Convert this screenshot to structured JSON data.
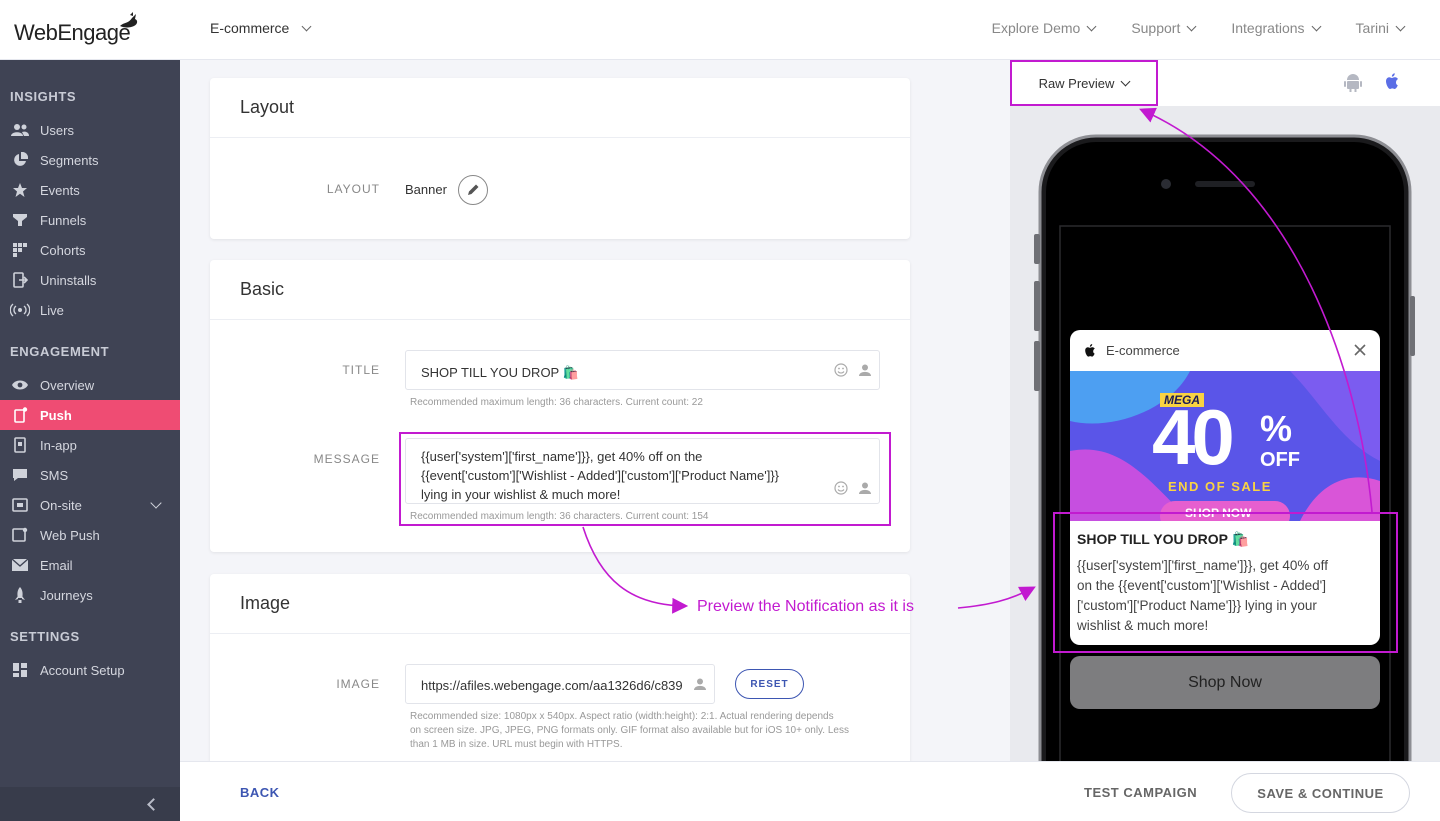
{
  "topbar": {
    "logo_text": "WebEngage",
    "project": "E-commerce",
    "nav": [
      {
        "label": "Explore Demo"
      },
      {
        "label": "Support"
      },
      {
        "label": "Integrations"
      },
      {
        "label": "Tarini"
      }
    ]
  },
  "sidebar": {
    "sections": {
      "insights": "INSIGHTS",
      "engagement": "ENGAGEMENT",
      "settings": "SETTINGS"
    },
    "insights_items": [
      "Users",
      "Segments",
      "Events",
      "Funnels",
      "Cohorts",
      "Uninstalls",
      "Live"
    ],
    "engagement_items": [
      "Overview",
      "Push",
      "In-app",
      "SMS",
      "On-site",
      "Web Push",
      "Email",
      "Journeys"
    ],
    "settings_items": [
      "Account Setup"
    ],
    "active_item": "Push"
  },
  "layout_card": {
    "title": "Layout",
    "label": "LAYOUT",
    "value": "Banner"
  },
  "basic_card": {
    "title": "Basic",
    "title_label": "TITLE",
    "title_value": "SHOP TILL YOU DROP 🛍️",
    "title_hint": "Recommended maximum length: 36 characters. Current count: 22",
    "message_label": "MESSAGE",
    "message_lines": [
      "{{user['system']['first_name']}}, get 40% off on the",
      "{{event['custom']['Wishlist - Added']['custom']['Product Name']}}",
      "lying in your wishlist & much more!"
    ],
    "message_hint": "Recommended maximum length: 36 characters. Current count: 154"
  },
  "image_card": {
    "title": "Image",
    "label": "IMAGE",
    "value": "https://afiles.webengage.com/aa1326d6/c839",
    "reset_label": "RESET",
    "hint_lines": [
      "Recommended size: 1080px x 540px. Aspect ratio (width:height): 2:1. Actual rendering depends",
      "on screen size. JPG, JPEG, PNG formats only. GIF format also available but for iOS 10+ only. Less",
      "than 1 MB in size. URL must begin with HTTPS."
    ]
  },
  "footer": {
    "back": "BACK",
    "test": "TEST CAMPAIGN",
    "save": "SAVE & CONTINUE"
  },
  "preview": {
    "mode": "Raw Preview",
    "app_name": "E-commerce",
    "banner": {
      "mega": "MEGA",
      "big": "40",
      "percent": "%",
      "off": "OFF",
      "end": "END OF SALE",
      "shop": "SHOP NOW"
    },
    "notif_title": "SHOP TILL YOU DROP 🛍️",
    "notif_lines": [
      "{{user['system']['first_name']}}, get 40% off",
      "on the {{event['custom']['Wishlist - Added']",
      "['custom']['Product Name']}} lying in your",
      "wishlist & much more!"
    ],
    "action_button": "Shop Now"
  },
  "annotation": {
    "text": "Preview the Notification as it is",
    "color": "#c21ad0"
  },
  "colors": {
    "sidebar_bg": "#3f4354",
    "active_bg": "#ef4c73",
    "link_blue": "#3d56b2"
  }
}
